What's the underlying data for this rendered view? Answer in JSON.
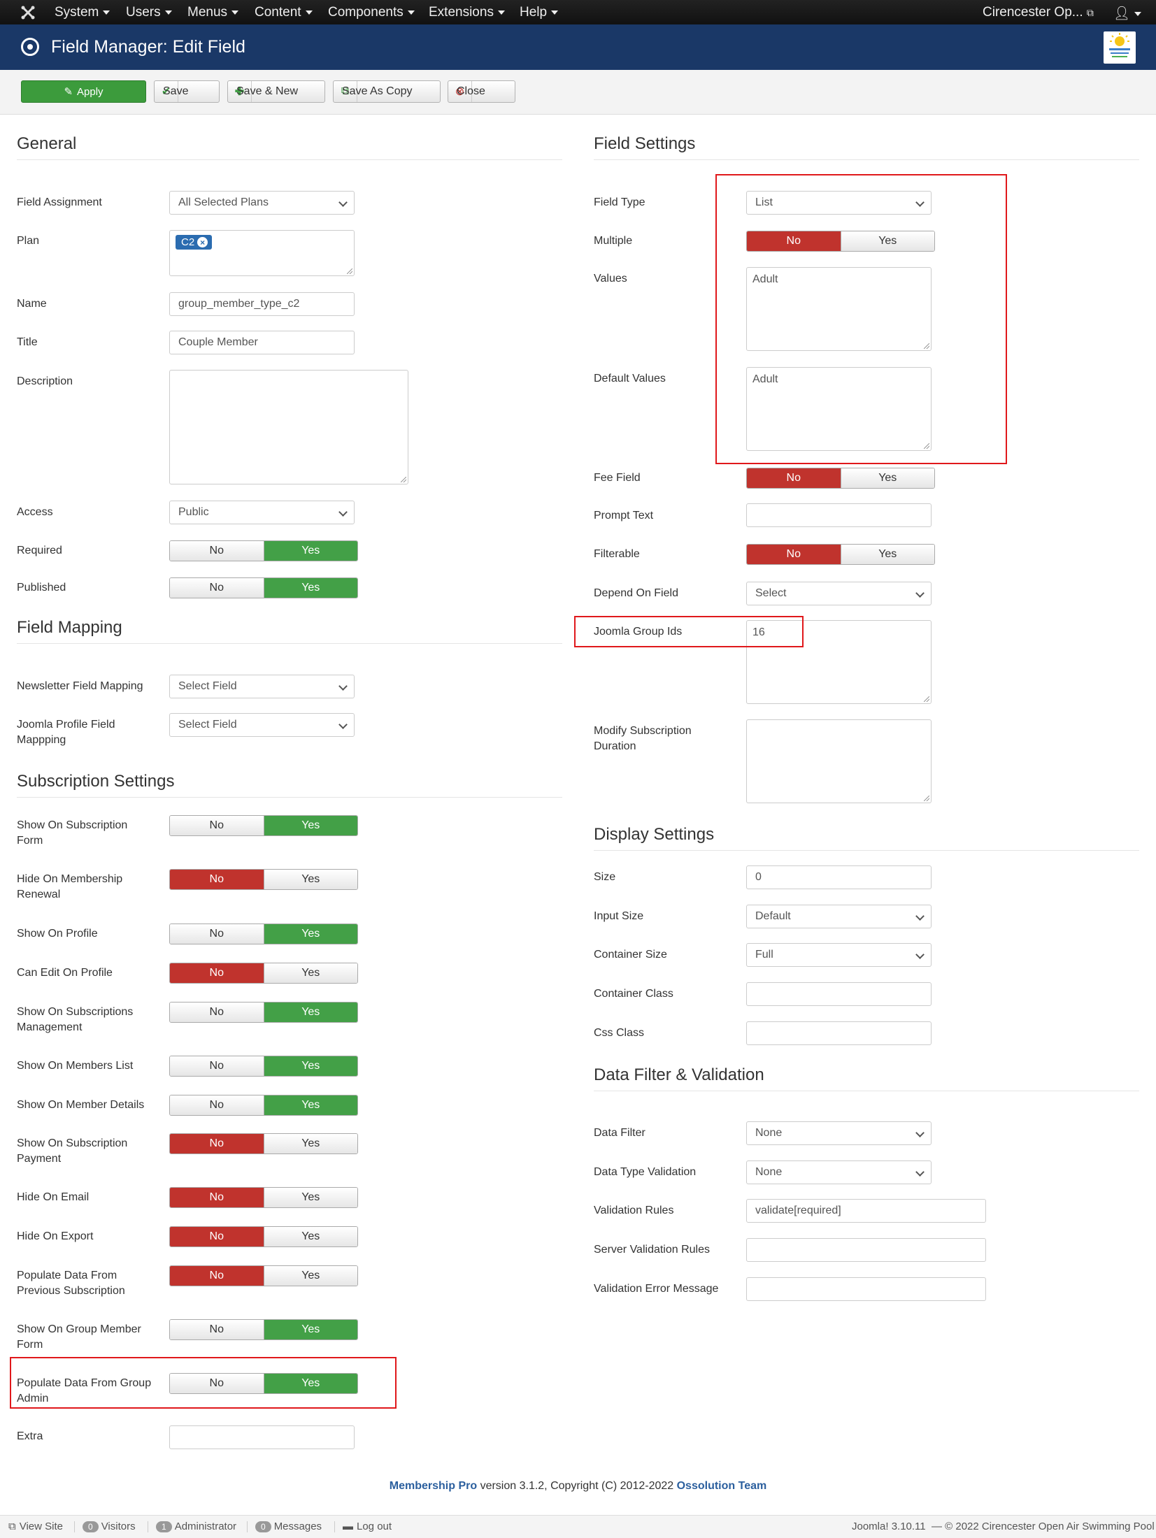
{
  "topnav": {
    "menus": [
      "System",
      "Users",
      "Menus",
      "Content",
      "Components",
      "Extensions",
      "Help"
    ],
    "site_name": "Cirencester Op...",
    "user_icon": "user-icon"
  },
  "header": {
    "title": "Field Manager: Edit Field"
  },
  "toolbar": {
    "apply": "Apply",
    "save": "Save",
    "save_new": "Save & New",
    "save_copy": "Save As Copy",
    "close": "Close"
  },
  "general": {
    "title": "General",
    "field_assignment": {
      "label": "Field Assignment",
      "value": "All Selected Plans"
    },
    "plan": {
      "label": "Plan",
      "tag": "C2"
    },
    "name": {
      "label": "Name",
      "value": "group_member_type_c2"
    },
    "title_field": {
      "label": "Title",
      "value": "Couple Member"
    },
    "description": {
      "label": "Description",
      "value": ""
    },
    "access": {
      "label": "Access",
      "value": "Public"
    },
    "required": {
      "label": "Required",
      "no": "No",
      "yes": "Yes"
    },
    "published": {
      "label": "Published",
      "no": "No",
      "yes": "Yes"
    }
  },
  "mapping": {
    "title": "Field Mapping",
    "newsletter": {
      "label": "Newsletter Field Mapping",
      "value": "Select Field"
    },
    "joomla_profile": {
      "label_1": "Joomla Profile Field",
      "label_2": "Mappping",
      "value": "Select Field"
    }
  },
  "subscription": {
    "title": "Subscription Settings",
    "rows": [
      {
        "l1": "Show On Subscription",
        "l2": "Form",
        "state": "yes"
      },
      {
        "l1": "Hide On Membership",
        "l2": "Renewal",
        "state": "no"
      },
      {
        "l1": "Show On Profile",
        "l2": "",
        "state": "yes"
      },
      {
        "l1": "Can Edit On Profile",
        "l2": "",
        "state": "no"
      },
      {
        "l1": "Show On Subscriptions",
        "l2": "Management",
        "state": "yes"
      },
      {
        "l1": "Show On Members List",
        "l2": "",
        "state": "yes"
      },
      {
        "l1": "Show On Member Details",
        "l2": "",
        "state": "yes"
      },
      {
        "l1": "Show On Subscription",
        "l2": "Payment",
        "state": "no"
      },
      {
        "l1": "Hide On Email",
        "l2": "",
        "state": "no"
      },
      {
        "l1": "Hide On Export",
        "l2": "",
        "state": "no"
      },
      {
        "l1": "Populate Data From",
        "l2": "Previous Subscription",
        "state": "no"
      },
      {
        "l1": "Show On Group Member",
        "l2": "Form",
        "state": "yes"
      },
      {
        "l1": "Populate Data From Group",
        "l2": "Admin",
        "state": "yes"
      }
    ],
    "no": "No",
    "yes": "Yes",
    "extra": {
      "label": "Extra",
      "value": ""
    }
  },
  "field_settings": {
    "title": "Field Settings",
    "field_type": {
      "label": "Field Type",
      "value": "List"
    },
    "multiple": {
      "label": "Multiple",
      "no": "No",
      "yes": "Yes"
    },
    "values": {
      "label": "Values",
      "value": "Adult"
    },
    "default_values": {
      "label": "Default Values",
      "value": "Adult"
    },
    "fee_field": {
      "label": "Fee Field",
      "no": "No",
      "yes": "Yes"
    },
    "prompt_text": {
      "label": "Prompt Text",
      "value": ""
    },
    "filterable": {
      "label": "Filterable",
      "no": "No",
      "yes": "Yes"
    },
    "depend_on": {
      "label": "Depend On Field",
      "value": "Select"
    },
    "group_ids": {
      "label": "Joomla Group Ids",
      "value": "16"
    },
    "modify_duration": {
      "label_1": "Modify Subscription",
      "label_2": "Duration",
      "value": ""
    }
  },
  "display": {
    "title": "Display Settings",
    "size": {
      "label": "Size",
      "value": "0"
    },
    "input_size": {
      "label": "Input Size",
      "value": "Default"
    },
    "container_size": {
      "label": "Container Size",
      "value": "Full"
    },
    "container_class": {
      "label": "Container Class",
      "value": ""
    },
    "css_class": {
      "label": "Css Class",
      "value": ""
    }
  },
  "validation": {
    "title": "Data Filter & Validation",
    "data_filter": {
      "label": "Data Filter",
      "value": "None"
    },
    "type_validation": {
      "label": "Data Type Validation",
      "value": "None"
    },
    "rules": {
      "label": "Validation Rules",
      "value": "validate[required]"
    },
    "server_rules": {
      "label": "Server Validation Rules",
      "value": ""
    },
    "error_msg": {
      "label": "Validation Error Message",
      "value": ""
    }
  },
  "footer": {
    "product": "Membership Pro",
    "text": " version 3.1.2, Copyright (C) 2012-2022 ",
    "team": "Ossolution Team"
  },
  "statusbar": {
    "view_site": "View Site",
    "visitors_count": "0",
    "visitors": "Visitors",
    "admin_count": "1",
    "admin": "Administrator",
    "messages_count": "0",
    "messages": "Messages",
    "logout": "Log out",
    "version": "Joomla! 3.10.11",
    "copyright": "— © 2022 Cirencester Open Air Swimming Pool"
  },
  "colors": {
    "header": "#1a3867",
    "green": "#43a047",
    "red": "#c0332d",
    "highlight": "#e0181b"
  }
}
